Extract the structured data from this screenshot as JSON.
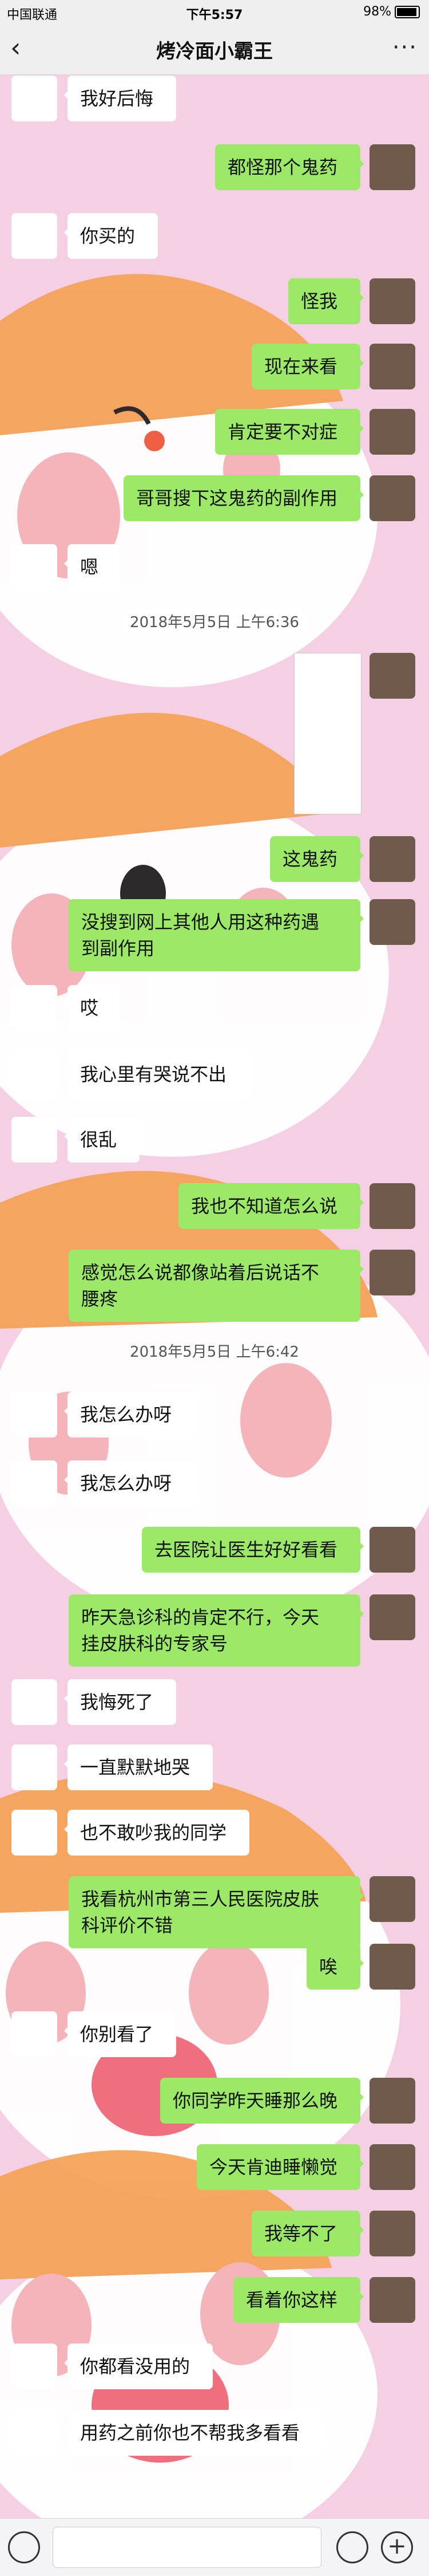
{
  "status_bar": {
    "carrier": "中国联通",
    "time": "下午5:57",
    "battery": "98%"
  },
  "nav": {
    "title": "烤冷面小霸王"
  },
  "messages": [
    {
      "side": "other",
      "text": "我好后悔"
    },
    {
      "side": "me",
      "text": "都怪那个鬼药"
    },
    {
      "side": "other",
      "text": "你买的"
    },
    {
      "side": "me",
      "text": "怪我"
    },
    {
      "side": "me",
      "text": "现在来看"
    },
    {
      "side": "me",
      "text": "肯定要不对症"
    },
    {
      "side": "me",
      "text": "哥哥搜下这鬼药的副作用"
    },
    {
      "side": "other",
      "text": "嗯"
    },
    {
      "type": "timestamp",
      "text": "2018年5月5日 上午6:36"
    },
    {
      "side": "me",
      "type": "image"
    },
    {
      "side": "me",
      "text": "这鬼药"
    },
    {
      "side": "me",
      "text": "没搜到网上其他人用这种药遇\n到副作用"
    },
    {
      "side": "other",
      "text": "哎"
    },
    {
      "side": "other",
      "text": "我心里有哭说不出"
    },
    {
      "side": "other",
      "text": "很乱"
    },
    {
      "side": "me",
      "text": "我也不知道怎么说"
    },
    {
      "side": "me",
      "text": "感觉怎么说都像站着后说话不\n腰疼"
    },
    {
      "type": "timestamp",
      "text": "2018年5月5日 上午6:42"
    },
    {
      "side": "other",
      "text": "我怎么办呀"
    },
    {
      "side": "other",
      "text": "我怎么办呀"
    },
    {
      "side": "me",
      "text": "去医院让医生好好看看"
    },
    {
      "side": "me",
      "text": "昨天急诊科的肯定不行，今天\n挂皮肤科的专家号"
    },
    {
      "side": "other",
      "text": "我悔死了"
    },
    {
      "side": "other",
      "text": "一直默默地哭"
    },
    {
      "side": "other",
      "text": "也不敢吵我的同学"
    },
    {
      "side": "me",
      "text": "我看杭州市第三人民医院皮肤\n科评价不错"
    },
    {
      "side": "me",
      "text": "唉"
    },
    {
      "side": "other",
      "text": "你别看了"
    },
    {
      "side": "me",
      "text": "你同学昨天睡那么晚"
    },
    {
      "side": "me",
      "text": "今天肯迪睡懒觉"
    },
    {
      "side": "me",
      "text": "我等不了"
    },
    {
      "side": "me",
      "text": "看着你这样"
    },
    {
      "side": "other",
      "text": "你都看没用的"
    },
    {
      "side": "other",
      "text": "用药之前你也不帮我多看看"
    }
  ],
  "icons": {
    "back": "chevron-left-icon",
    "more": "more-dots-icon",
    "voice": "voice-icon",
    "emoji": "emoji-icon",
    "plus": "plus-icon"
  },
  "colors": {
    "my_bubble": "#9ce967",
    "other_bubble": "#ffffff",
    "background": "#f6d2e6"
  }
}
